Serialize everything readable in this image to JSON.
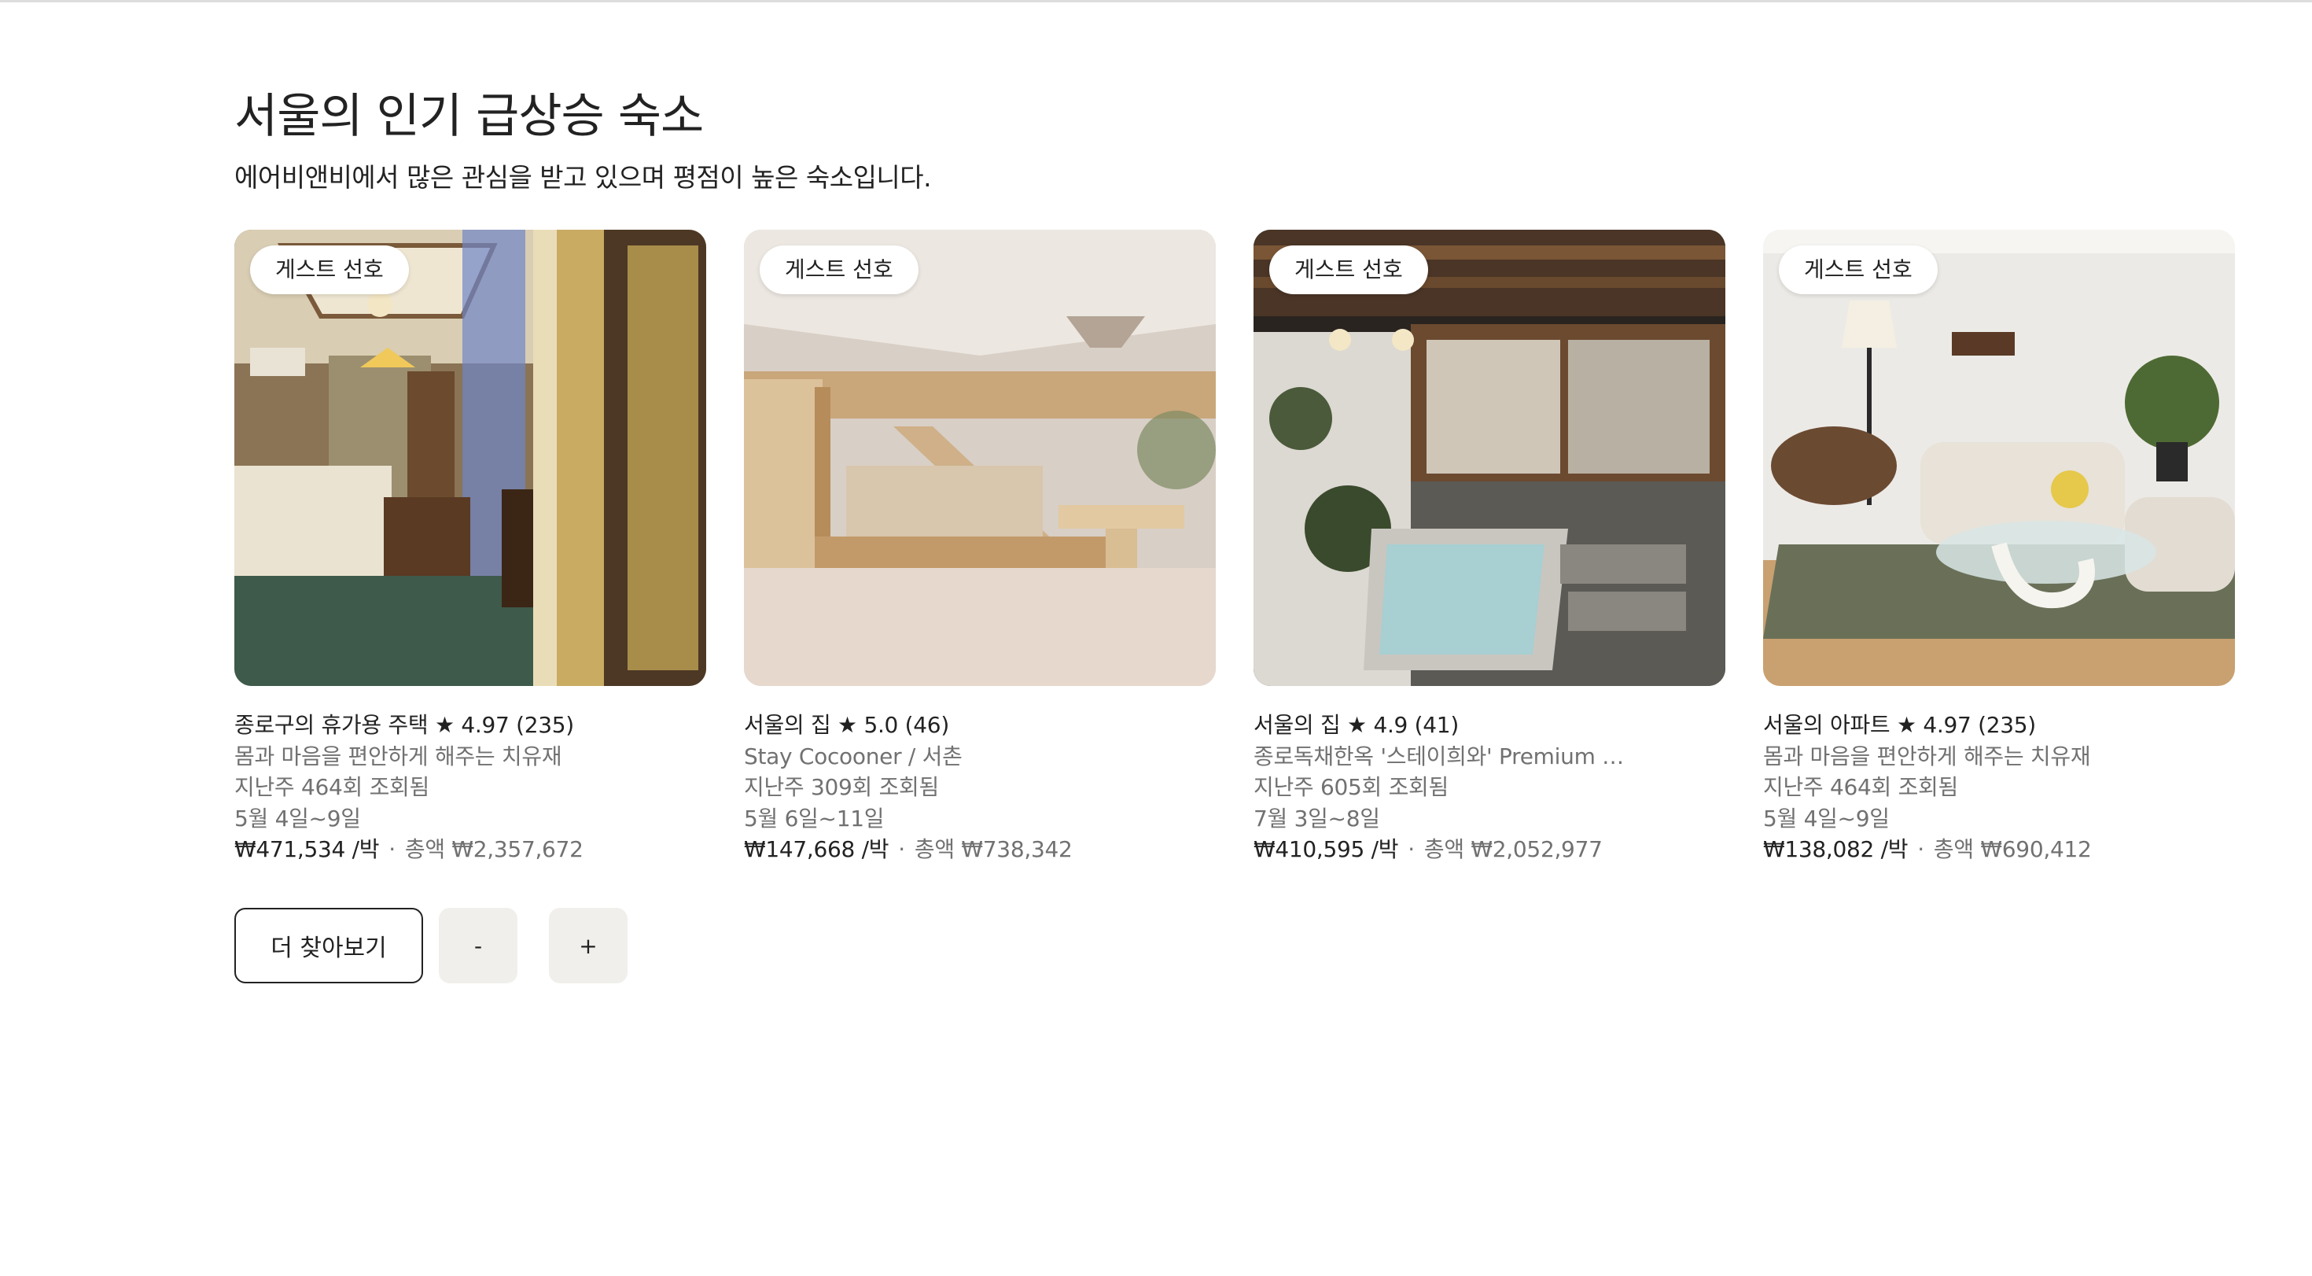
{
  "section": {
    "title": "서울의 인기 급상승 숙소",
    "subtitle": "에어비앤비에서 많은 관심을 받고 있으며 평점이 높은 숙소입니다."
  },
  "listings": [
    {
      "badge": "게스트 선호",
      "headline": "종로구의 휴가용 주택 ★ 4.97 (235)",
      "name": "몸과 마음을 편안하게 해주는 치유재",
      "views": "지난주 464회 조회됨",
      "dates": "5월 4일~9일",
      "price": "₩471,534 /박",
      "separator": "·",
      "total": "총액 ₩2,357,672",
      "image_icon": "bedroom-photo"
    },
    {
      "badge": "게스트 선호",
      "headline": "서울의 집 ★ 5.0 (46)",
      "name": "Stay Cocooner / 서촌",
      "views": "지난주 309회 조회됨",
      "dates": "5월 6일~11일",
      "price": "₩147,668 /박",
      "separator": "·",
      "total": "총액 ₩738,342",
      "image_icon": "wooden-loft-photo"
    },
    {
      "badge": "게스트 선호",
      "headline": "서울의 집 ★ 4.9 (41)",
      "name": "종로독채한옥 '스테이희와' Premium …",
      "views": "지난주 605회 조회됨",
      "dates": "7월 3일~8일",
      "price": "₩410,595 /박",
      "separator": "·",
      "total": "총액 ₩2,052,977",
      "image_icon": "hanok-courtyard-pool-photo"
    },
    {
      "badge": "게스트 선호",
      "headline": "서울의 아파트 ★ 4.97 (235)",
      "name": "몸과 마음을 편안하게 해주는 치유재",
      "views": "지난주 464회 조회됨",
      "dates": "5월 4일~9일",
      "price": "₩138,082 /박",
      "separator": "·",
      "total": "총액 ₩690,412",
      "image_icon": "living-room-photo"
    }
  ],
  "actions": {
    "more_label": "더 찾아보기",
    "minus_label": "-",
    "plus_label": "+"
  },
  "colors": {
    "text_primary": "#222222",
    "text_secondary": "#717171",
    "stepper_bg": "#f0efec"
  }
}
